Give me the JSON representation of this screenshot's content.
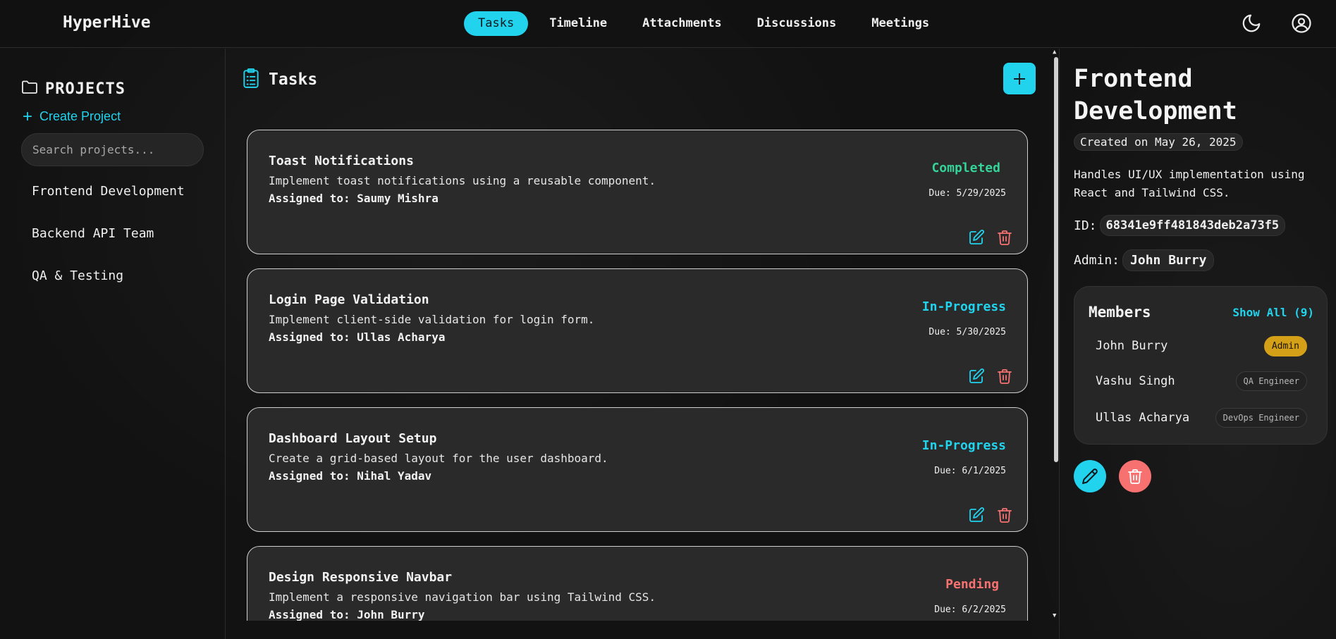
{
  "app": {
    "brand": "HyperHive"
  },
  "nav": {
    "tabs": [
      {
        "label": "Tasks",
        "active": true
      },
      {
        "label": "Timeline"
      },
      {
        "label": "Attachments"
      },
      {
        "label": "Discussions"
      },
      {
        "label": "Meetings"
      }
    ]
  },
  "icons": {
    "theme": "moon-icon",
    "account": "user-circle-icon",
    "folder": "folder-icon",
    "clipboard": "clipboard-list-icon",
    "edit": "edit-icon",
    "delete": "trash-icon",
    "pencil": "pencil-icon"
  },
  "colors": {
    "accent": "#22d3ee",
    "completed": "#34d399",
    "in_progress": "#22d3ee",
    "pending": "#f87171",
    "delete": "#f87171",
    "admin_badge": "#d4a017"
  },
  "sidebar": {
    "heading": "PROJECTS",
    "create_label": "Create Project",
    "search_placeholder": "Search projects...",
    "projects": [
      {
        "name": "Frontend Development"
      },
      {
        "name": "Backend API Team"
      },
      {
        "name": "QA & Testing"
      }
    ]
  },
  "main": {
    "heading": "Tasks",
    "tasks": [
      {
        "title": "Toast Notifications",
        "description": "Implement toast notifications using a reusable component.",
        "assigned": "Assigned to: Saumy Mishra",
        "status": "Completed",
        "due": "Due: 5/29/2025"
      },
      {
        "title": "Login Page Validation",
        "description": "Implement client-side validation for login form.",
        "assigned": "Assigned to: Ullas Acharya",
        "status": "In-Progress",
        "due": "Due: 5/30/2025"
      },
      {
        "title": "Dashboard Layout Setup",
        "description": "Create a grid-based layout for the user dashboard.",
        "assigned": "Assigned to: Nihal Yadav",
        "status": "In-Progress",
        "due": "Due: 6/1/2025"
      },
      {
        "title": "Design Responsive Navbar",
        "description": "Implement a responsive navigation bar using Tailwind CSS.",
        "assigned": "Assigned to: John Burry",
        "status": "Pending",
        "due": "Due: 6/2/2025"
      }
    ]
  },
  "detail": {
    "title": "Frontend Development",
    "created": "Created on May 26, 2025",
    "description": "Handles UI/UX implementation using React and Tailwind CSS.",
    "id_label": "ID:",
    "id_value": "68341e9ff481843deb2a73f5",
    "admin_label": "Admin:",
    "admin_value": "John Burry",
    "members_title": "Members",
    "show_all": "Show All (9)",
    "members": [
      {
        "name": "John Burry",
        "role": "Admin"
      },
      {
        "name": "Vashu Singh",
        "role": "QA Engineer"
      },
      {
        "name": "Ullas Acharya",
        "role": "DevOps Engineer"
      }
    ]
  }
}
